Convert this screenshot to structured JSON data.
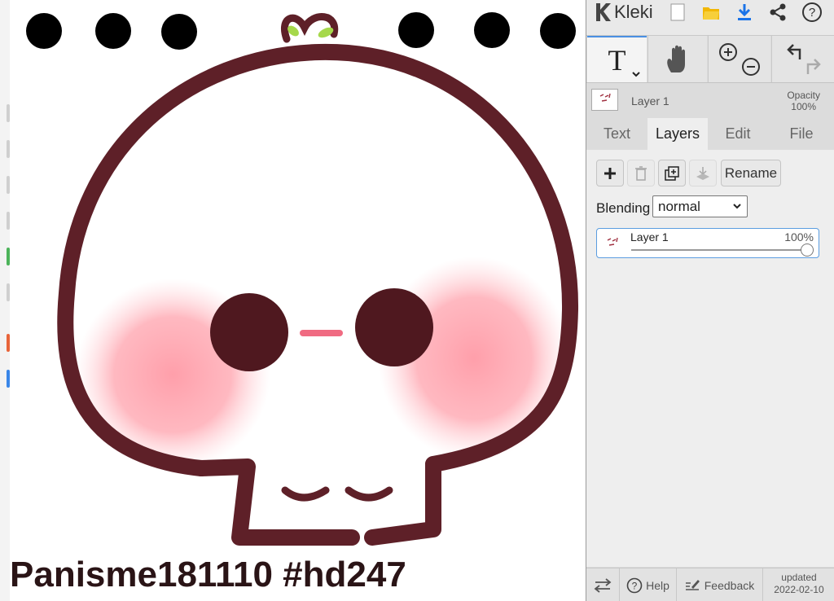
{
  "canvas": {
    "caption": "Panisme181110 #hd247",
    "colors": {
      "outline": "#5e2028",
      "eyes": "#4f181f",
      "blush": "#ff9aa6",
      "nose": "#f06b82",
      "leaf": "#a6d84b"
    }
  },
  "panel": {
    "app_name": "Kleki",
    "top_icons": [
      "new-file-icon",
      "open-folder-icon",
      "download-icon",
      "share-icon",
      "help-circle-icon"
    ],
    "tools": {
      "text_tool_glyph": "T",
      "hand_tool": "hand-icon",
      "zoom_tool": "zoom-in-out-icon",
      "undo_redo": "undo-redo-icon"
    },
    "current_layer": {
      "name": "Layer 1",
      "opacity_label": "Opacity",
      "opacity_value": "100%"
    },
    "tabs": [
      {
        "label": "Text",
        "active": false
      },
      {
        "label": "Layers",
        "active": true
      },
      {
        "label": "Edit",
        "active": false
      },
      {
        "label": "File",
        "active": false
      }
    ],
    "layers_tab": {
      "rename_label": "Rename",
      "blending_label": "Blending",
      "blending_value": "normal",
      "layers": [
        {
          "name": "Layer 1",
          "opacity": "100%",
          "opacity_fraction": 1.0
        }
      ]
    },
    "footer": {
      "help_label": "Help",
      "feedback_label": "Feedback",
      "updated_label": "updated",
      "updated_date": "2022-02-10"
    },
    "accent_color": "#4a90e2"
  }
}
